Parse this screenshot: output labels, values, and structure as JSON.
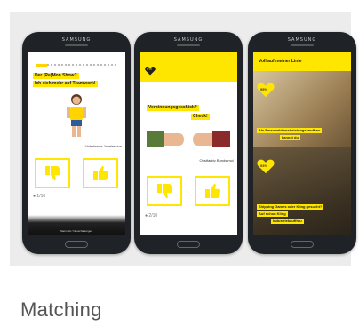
{
  "card": {
    "title": "Matching"
  },
  "phones": [
    {
      "brand": "SAMSUNG",
      "question_line1": "Der (Re)Mon Show?",
      "question_line2": "Ich sieh mehr auf Teamwork!",
      "caption": "Unterfande Jahrfassion",
      "pagination": "● 1/10",
      "footer": "Sammelt / Neuschaltungen"
    },
    {
      "brand": "SAMSUNG",
      "badge": "0%",
      "question_line1": "Verbindungsgeschick?",
      "question_line2": "Check!",
      "caption": "Obstfarbiv Bundstmo!",
      "pagination": "● 2/10"
    },
    {
      "brand": "SAMSUNG",
      "header": "Voll auf meiner Linie",
      "badge1": "95%",
      "match1_line1": "Als Personaldienstleistungskauffrau",
      "match1_line2": "kannst du",
      "badge2": "93%",
      "match2_line1": "Shipping Games oder Kling gesucht?",
      "match2_line2": "Auf schon Kling",
      "match2_line3": "Industriekauffrau"
    }
  ],
  "colors": {
    "accent": "#ffe600",
    "phone_body": "#1f2226",
    "title_text": "#555555"
  },
  "icons": {
    "thumbs_down": "thumbs-down-icon",
    "thumbs_up": "thumbs-up-icon"
  }
}
